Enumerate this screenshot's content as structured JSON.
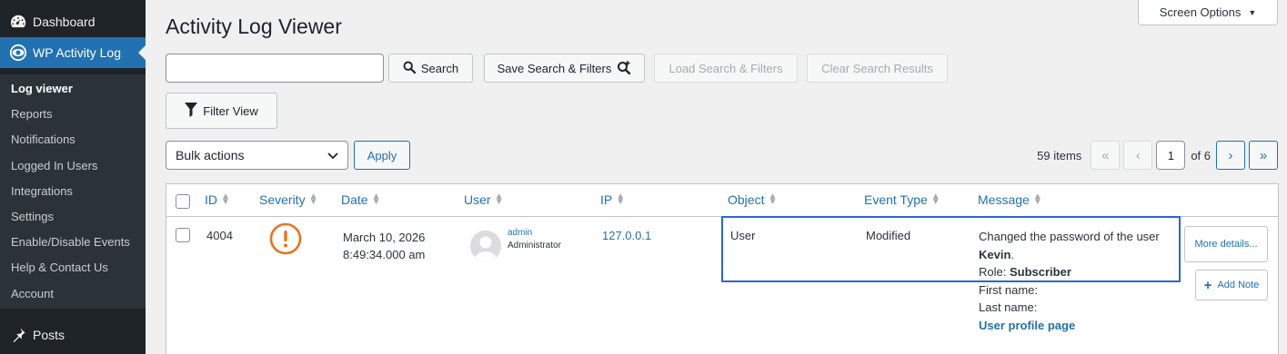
{
  "sidebar": {
    "dashboard": "Dashboard",
    "plugin": "WP Activity Log",
    "items": [
      {
        "label": "Log viewer"
      },
      {
        "label": "Reports"
      },
      {
        "label": "Notifications"
      },
      {
        "label": "Logged In Users"
      },
      {
        "label": "Integrations"
      },
      {
        "label": "Settings"
      },
      {
        "label": "Enable/Disable Events"
      },
      {
        "label": "Help & Contact Us"
      },
      {
        "label": "Account"
      }
    ],
    "posts": "Posts"
  },
  "header": {
    "title": "Activity Log Viewer",
    "screen_options": "Screen Options"
  },
  "search": {
    "value": "",
    "button": "Search",
    "save": "Save Search & Filters",
    "load": "Load Search & Filters",
    "clear": "Clear Search Results",
    "filter": "Filter View"
  },
  "bulk": {
    "selected": "Bulk actions",
    "apply": "Apply"
  },
  "pagination": {
    "items": "59 items",
    "first": "«",
    "prev": "‹",
    "current": "1",
    "of": "of 6",
    "next": "›",
    "last": "»"
  },
  "table": {
    "columns": [
      "ID",
      "Severity",
      "Date",
      "User",
      "IP",
      "Object",
      "Event Type",
      "Message"
    ],
    "row": {
      "id": "4004",
      "severity_icon": "warning-circle-icon",
      "date_line1": "March 10, 2026",
      "date_line2": "8:49:34.000 am",
      "user": "admin",
      "role": "Administrator",
      "ip": "127.0.0.1",
      "object": "User",
      "event_type": "Modified",
      "message": {
        "line1": "Changed the password of the user",
        "username": "Kevin",
        "role_label": "Role:",
        "role_value": "Subscriber",
        "first_name": "First name:",
        "last_name": "Last name:",
        "profile_link": "User profile page"
      },
      "more_details": "More details...",
      "add_note": "Add Note"
    }
  },
  "colors": {
    "accent": "#2271b1",
    "sidebar_bg": "#1d2327",
    "severity": "#e8741e",
    "highlight": "#2a66d4"
  }
}
